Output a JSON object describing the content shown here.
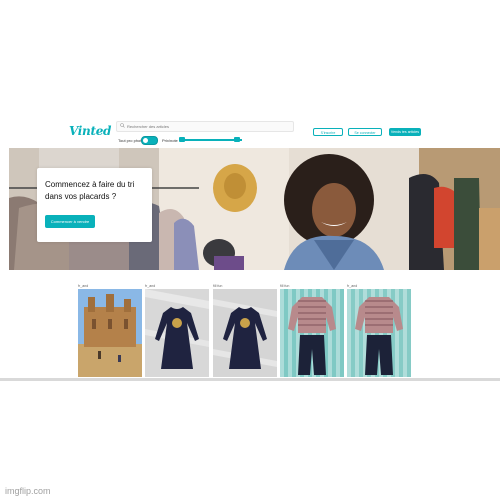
{
  "header": {
    "logo": "Vinted",
    "search_placeholder": "Rechercher des articles",
    "buttons": [
      "S'inscrire",
      "Se connecter",
      "Vends tes articles"
    ],
    "toggle_label": "Tout pro photo",
    "slider_label": "Prix/note",
    "accent_color": "#09b1ba"
  },
  "hero": {
    "title": "Commencez à faire du tri dans vos placards ?",
    "cta": "Commencer à vendre"
  },
  "items": [
    {
      "seller": "fr_and",
      "subject": "mud mosque building"
    },
    {
      "seller": "fr_and",
      "subject": "navy dress with print"
    },
    {
      "seller": "fill fun",
      "subject": "navy dress with print"
    },
    {
      "seller": "fill fun",
      "subject": "striped shirt and jeans"
    },
    {
      "seller": "fr_and",
      "subject": "striped shirt and jeans"
    }
  ],
  "watermark": "imgflip.com"
}
